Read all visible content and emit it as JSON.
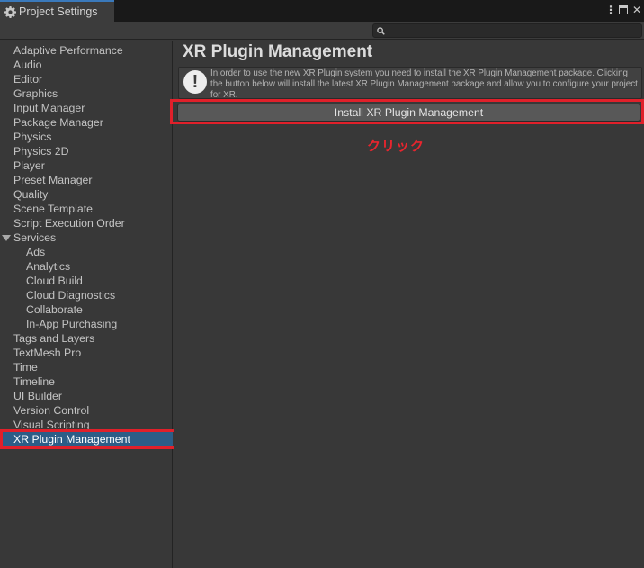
{
  "window": {
    "tab_title": "Project Settings",
    "tab_icon": "gear-icon",
    "controls": [
      "more-options-icon",
      "maximize-icon",
      "close-icon"
    ],
    "accent": "#3a79bb"
  },
  "search": {
    "placeholder": "",
    "icon": "search-icon"
  },
  "sidebar": {
    "items": [
      {
        "label": "Adaptive Performance"
      },
      {
        "label": "Audio"
      },
      {
        "label": "Editor"
      },
      {
        "label": "Graphics"
      },
      {
        "label": "Input Manager"
      },
      {
        "label": "Package Manager"
      },
      {
        "label": "Physics"
      },
      {
        "label": "Physics 2D"
      },
      {
        "label": "Player"
      },
      {
        "label": "Preset Manager"
      },
      {
        "label": "Quality"
      },
      {
        "label": "Scene Template"
      },
      {
        "label": "Script Execution Order"
      },
      {
        "label": "Services",
        "expanded": true
      },
      {
        "label": "Ads"
      },
      {
        "label": "Analytics"
      },
      {
        "label": "Cloud Build"
      },
      {
        "label": "Cloud Diagnostics"
      },
      {
        "label": "Collaborate"
      },
      {
        "label": "In-App Purchasing"
      },
      {
        "label": "Tags and Layers"
      },
      {
        "label": "TextMesh Pro"
      },
      {
        "label": "Time"
      },
      {
        "label": "Timeline"
      },
      {
        "label": "UI Builder"
      },
      {
        "label": "Version Control"
      },
      {
        "label": "Visual Scripting"
      },
      {
        "label": "XR Plugin Management",
        "selected": true
      }
    ],
    "selected_color": "#2c5d87"
  },
  "main": {
    "title": "XR Plugin Management",
    "help_text": "In order to use the new XR Plugin system you need to install the XR Plugin Management package. Clicking the button below will install the latest XR Plugin Management package and allow you to configure your project for XR.",
    "help_icon": "info-icon",
    "install_button": "Install XR Plugin Management"
  },
  "annotation": {
    "click_label": "クリック",
    "highlight_color": "#e0202a"
  }
}
